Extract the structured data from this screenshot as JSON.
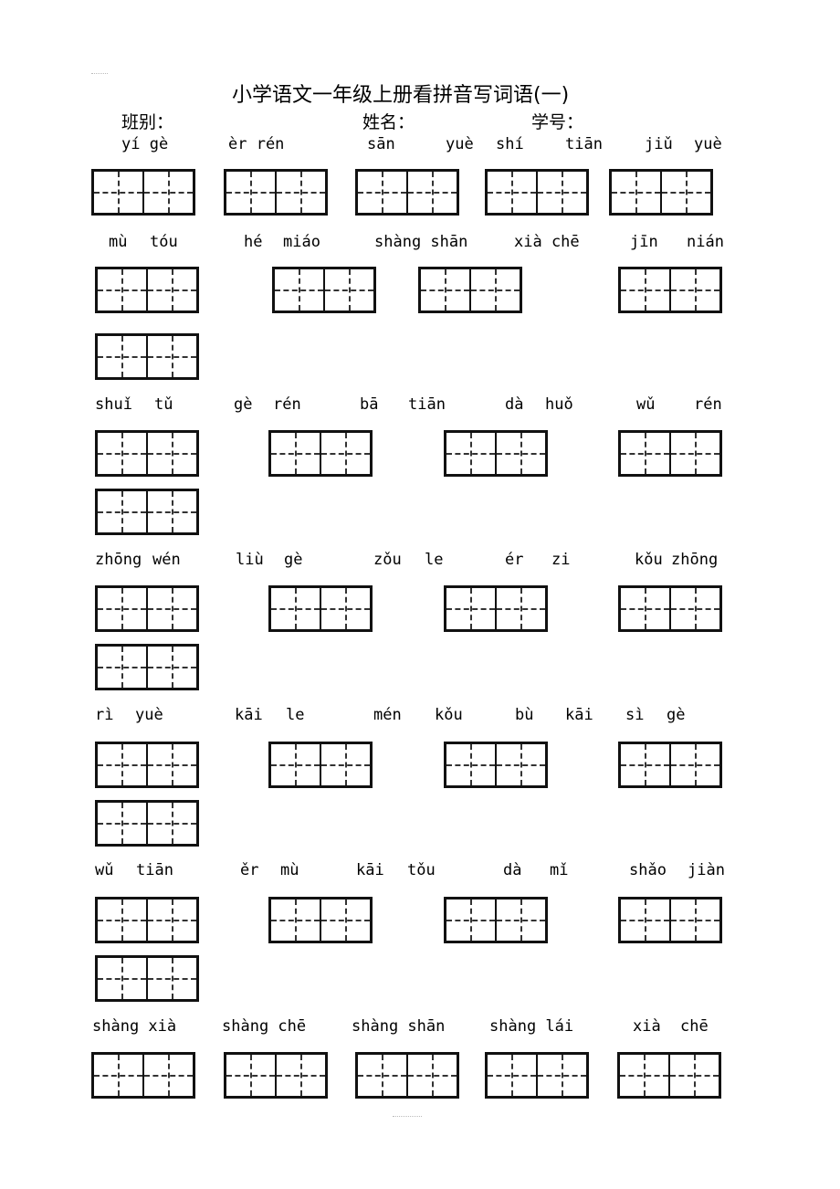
{
  "title": "小学语文一年级上册看拼音写词语(一)",
  "header": {
    "class_label": "班别：",
    "name_label": "姓名：",
    "id_label": "学号："
  },
  "rows": [
    {
      "pinyin": [
        "yí gè",
        "èr rén",
        "sān",
        "yuè",
        "shí",
        "tiān",
        "jiǔ",
        "yuè"
      ],
      "box_count": 5
    },
    {
      "pinyin": [
        "mù",
        "tóu",
        "hé",
        "miáo",
        "shàng shān",
        "xià chē",
        "jīn",
        "nián"
      ],
      "box_count": 5
    },
    {
      "pinyin": [
        "shuǐ",
        "tǔ",
        "gè",
        "rén",
        "bā",
        "tiān",
        "dà",
        "huǒ",
        "wǔ",
        "rén"
      ],
      "box_count": 5
    },
    {
      "pinyin": [
        "zhōng",
        "wén",
        "liù",
        "gè",
        "zǒu",
        "le",
        "ér",
        "zi",
        "kǒu",
        "zhōng"
      ],
      "box_count": 5
    },
    {
      "pinyin": [
        "rì",
        "yuè",
        "kāi",
        "le",
        "mén",
        "kǒu",
        "bù",
        "kāi",
        "sì",
        "gè"
      ],
      "box_count": 5
    },
    {
      "pinyin": [
        "wǔ",
        "tiān",
        "ěr",
        "mù",
        "kāi",
        "tǒu",
        "dà",
        "mǐ",
        "shǎo",
        "jiàn"
      ],
      "box_count": 5
    },
    {
      "pinyin": [
        "shàng xià",
        "shàng chē",
        "shàng shān",
        "shàng lái",
        "xià",
        "chē"
      ],
      "box_count": 5
    }
  ]
}
